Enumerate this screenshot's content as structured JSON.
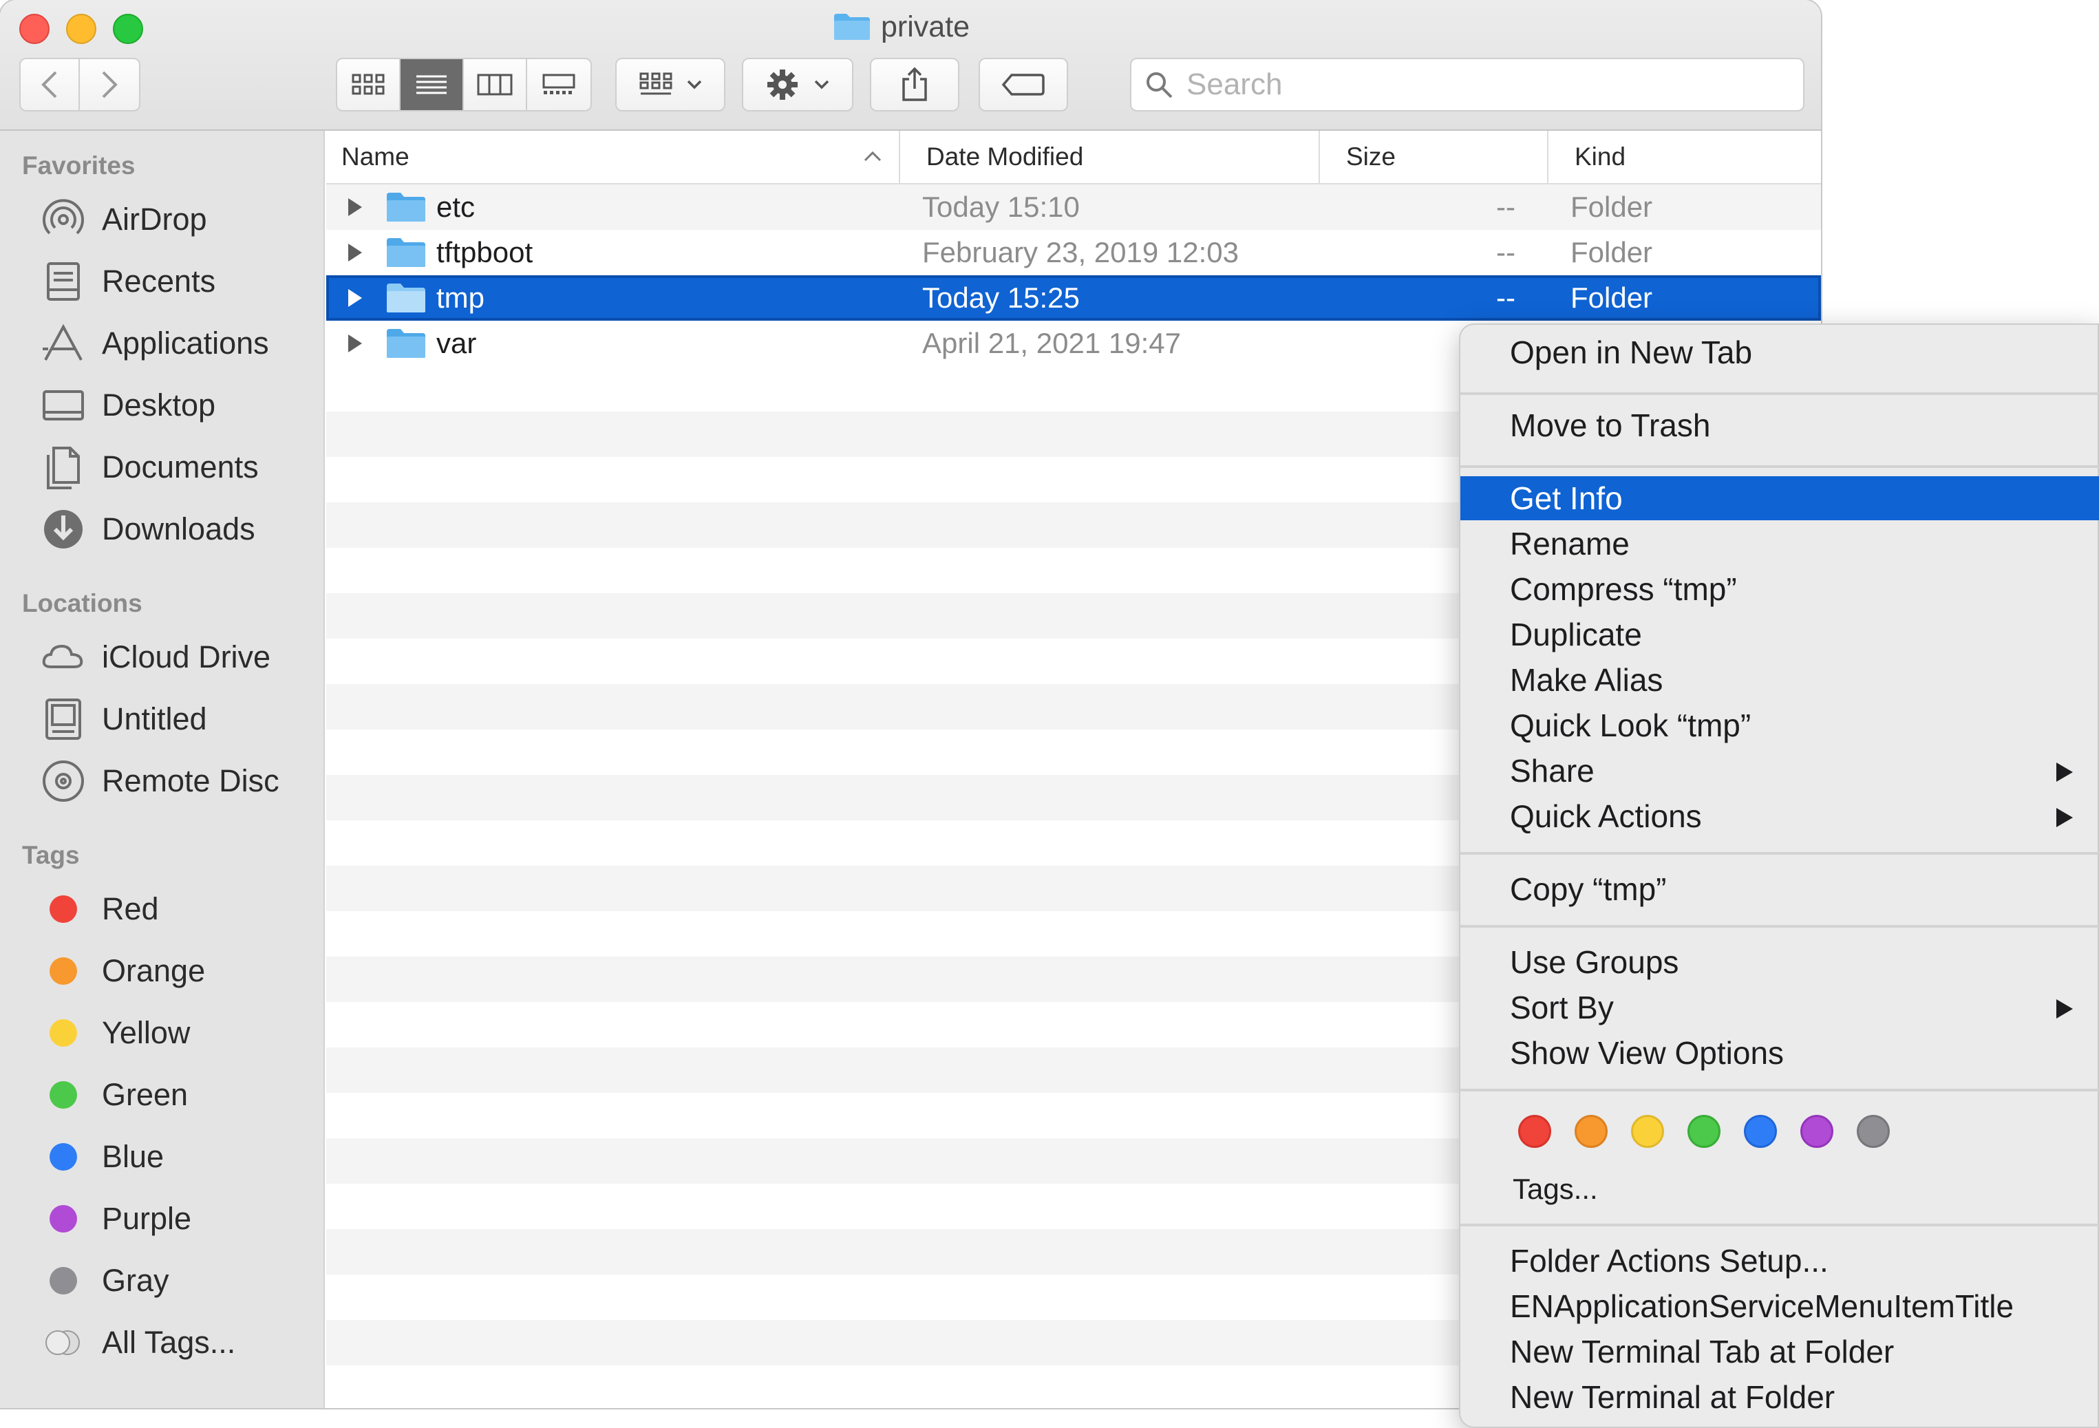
{
  "window": {
    "title": "private"
  },
  "toolbar": {
    "search_placeholder": "Search"
  },
  "sidebar": {
    "favorites_heading": "Favorites",
    "favorites": [
      {
        "label": "AirDrop",
        "icon": "airdrop-icon"
      },
      {
        "label": "Recents",
        "icon": "recents-icon"
      },
      {
        "label": "Applications",
        "icon": "applications-icon"
      },
      {
        "label": "Desktop",
        "icon": "desktop-icon"
      },
      {
        "label": "Documents",
        "icon": "documents-icon"
      },
      {
        "label": "Downloads",
        "icon": "downloads-icon"
      }
    ],
    "locations_heading": "Locations",
    "locations": [
      {
        "label": "iCloud Drive",
        "icon": "cloud-icon"
      },
      {
        "label": "Untitled",
        "icon": "disk-icon"
      },
      {
        "label": "Remote Disc",
        "icon": "disc-icon"
      }
    ],
    "tags_heading": "Tags",
    "tags": [
      {
        "label": "Red",
        "color": "#f0433a"
      },
      {
        "label": "Orange",
        "color": "#f7992e"
      },
      {
        "label": "Yellow",
        "color": "#fbd13a"
      },
      {
        "label": "Green",
        "color": "#4cc84a"
      },
      {
        "label": "Blue",
        "color": "#2f7df6"
      },
      {
        "label": "Purple",
        "color": "#b04bd6"
      },
      {
        "label": "Gray",
        "color": "#8e8e93"
      },
      {
        "label": "All Tags...",
        "color": "none"
      }
    ]
  },
  "columns": {
    "name": "Name",
    "date": "Date Modified",
    "size": "Size",
    "kind": "Kind"
  },
  "files": [
    {
      "name": "etc",
      "date": "Today 15:10",
      "size": "--",
      "kind": "Folder"
    },
    {
      "name": "tftpboot",
      "date": "February 23, 2019 12:03",
      "size": "--",
      "kind": "Folder"
    },
    {
      "name": "tmp",
      "date": "Today 15:25",
      "size": "--",
      "kind": "Folder",
      "selected": true
    },
    {
      "name": "var",
      "date": "April 21, 2021 19:47",
      "size": "--",
      "kind": "Folder"
    }
  ],
  "context_menu": {
    "open_new_tab": "Open in New Tab",
    "move_to_trash": "Move to Trash",
    "get_info": "Get Info",
    "rename": "Rename",
    "compress": "Compress “tmp”",
    "duplicate": "Duplicate",
    "make_alias": "Make Alias",
    "quick_look": "Quick Look “tmp”",
    "share": "Share",
    "quick_actions": "Quick Actions",
    "copy": "Copy “tmp”",
    "use_groups": "Use Groups",
    "sort_by": "Sort By",
    "show_view_options": "Show View Options",
    "tag_colors": [
      "#f0433a",
      "#f7992e",
      "#fbd13a",
      "#4cc84a",
      "#2f7df6",
      "#b04bd6",
      "#8e8e93"
    ],
    "tags": "Tags...",
    "folder_actions_setup": "Folder Actions Setup...",
    "en_app_service": "ENApplicationServiceMenuItemTitle",
    "new_terminal_tab": "New Terminal Tab at Folder",
    "new_terminal": "New Terminal at Folder"
  }
}
